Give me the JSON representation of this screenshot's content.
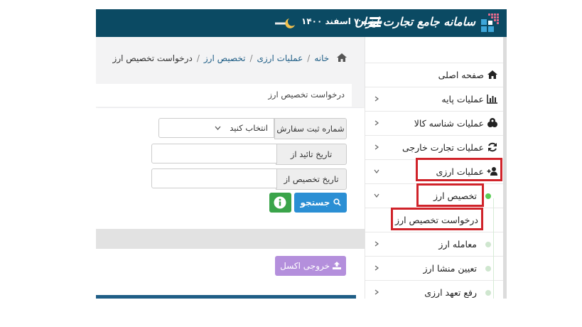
{
  "header": {
    "logo_text": "سامانه جامع تجارت ایران",
    "date": "شنبه ۷ اسفند ۱۴۰۰"
  },
  "breadcrumb": {
    "items": [
      "خانه",
      "عملیات ارزی",
      "تخصیص ارز",
      "درخواست تخصیص ارز"
    ]
  },
  "panel": {
    "title": "درخواست تخصیص ارز"
  },
  "form": {
    "order_number_label": "شماره ثبت سفارش",
    "order_number_select": "انتخاب کنید",
    "approval_date_label": "تاریخ تائید از",
    "approval_date_value": "",
    "allocation_date_label": "تاریخ تخصیص از",
    "allocation_date_value": "",
    "search_label": "جستجو"
  },
  "table": {
    "excel_label": "خروجی اکسل"
  },
  "sidebar": {
    "items": [
      {
        "label": "صفحه اصلی",
        "icon": "home-icon"
      },
      {
        "label": "عملیات پایه",
        "icon": "bar-chart-icon"
      },
      {
        "label": "عملیات شناسه کالا",
        "icon": "cubes-icon"
      },
      {
        "label": "عملیات تجارت خارجی",
        "icon": "refresh-icon"
      },
      {
        "label": "عملیات ارزی",
        "icon": "user-plus-icon"
      }
    ],
    "sub_items": [
      {
        "label": "تخصیص ارز"
      },
      {
        "label": "درخواست تخصیص ارز"
      },
      {
        "label": "معامله ارز"
      },
      {
        "label": "تعیین منشا ارز"
      },
      {
        "label": "رفع تعهد ارزی"
      }
    ]
  },
  "colors": {
    "header_bg": "#0b4a63",
    "search_button": "#2b8fd4",
    "info_button": "#3aa44a",
    "excel_button": "#b48fdc",
    "highlight": "#d0232a",
    "active_dot": "#5bcd55"
  }
}
